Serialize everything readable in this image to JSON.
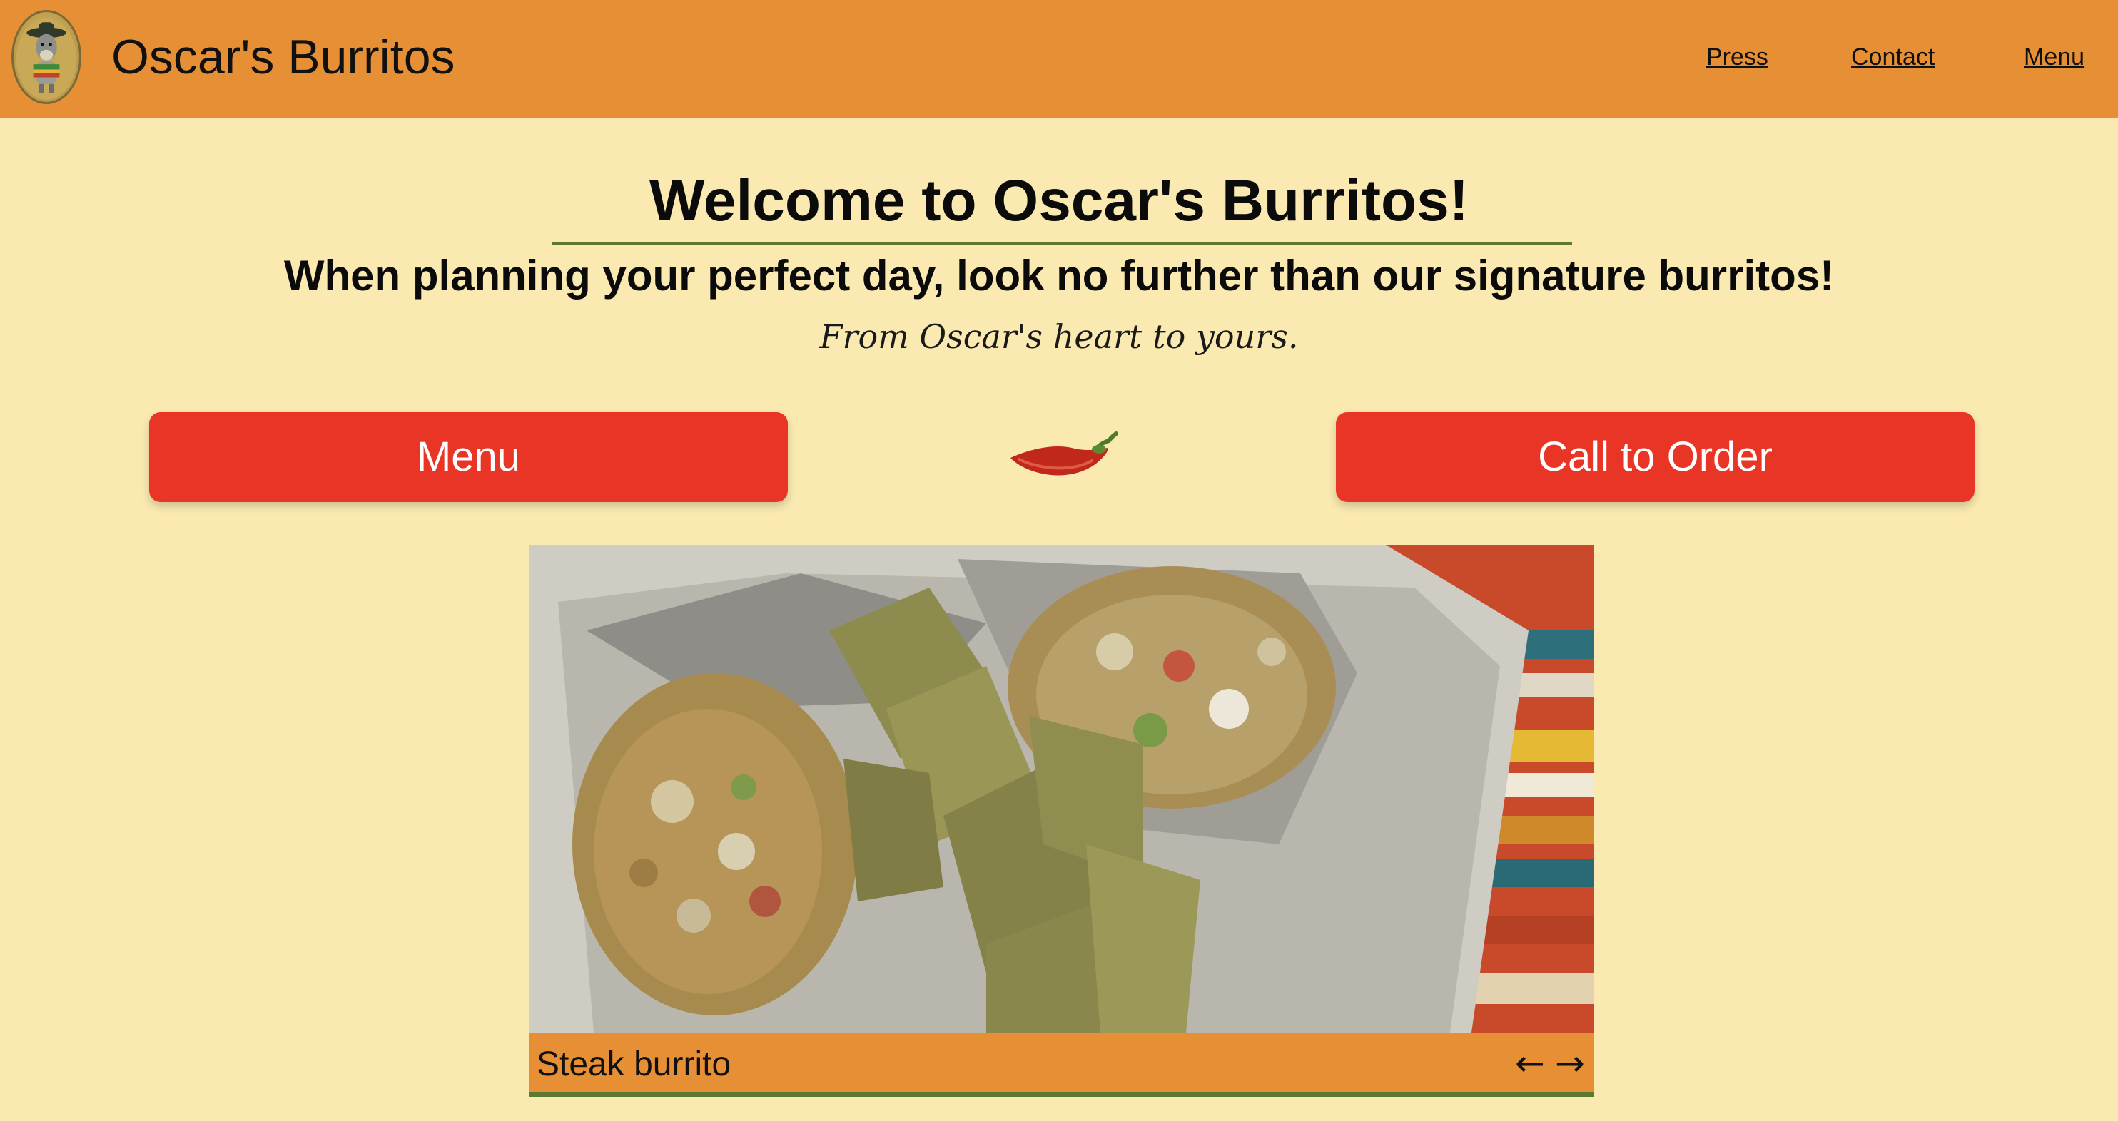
{
  "header": {
    "site_title": "Oscar's Burritos",
    "logo_icon": "donkey-mascot-logo",
    "nav": [
      {
        "label": "Press"
      },
      {
        "label": "Contact"
      },
      {
        "label": "Menu"
      }
    ],
    "background_color": "#e78f35"
  },
  "hero": {
    "heading": "Welcome to Oscar's Burritos!",
    "tagline": "When planning your perfect day, look no further than our signature burritos!",
    "motto": "From Oscar's heart to yours."
  },
  "actions": {
    "menu_label": "Menu",
    "order_label": "Call to Order",
    "button_color": "#e83525",
    "divider_icon": "chili-pepper-icon"
  },
  "carousel": {
    "caption": "Steak burrito",
    "prev_icon": "arrow-left-icon",
    "prev_glyph": "←",
    "next_icon": "arrow-right-icon",
    "next_glyph": "→",
    "caption_bar_color": "#e78f35",
    "accent_color": "#5d7830"
  },
  "page": {
    "background_color": "#fae9b0"
  }
}
